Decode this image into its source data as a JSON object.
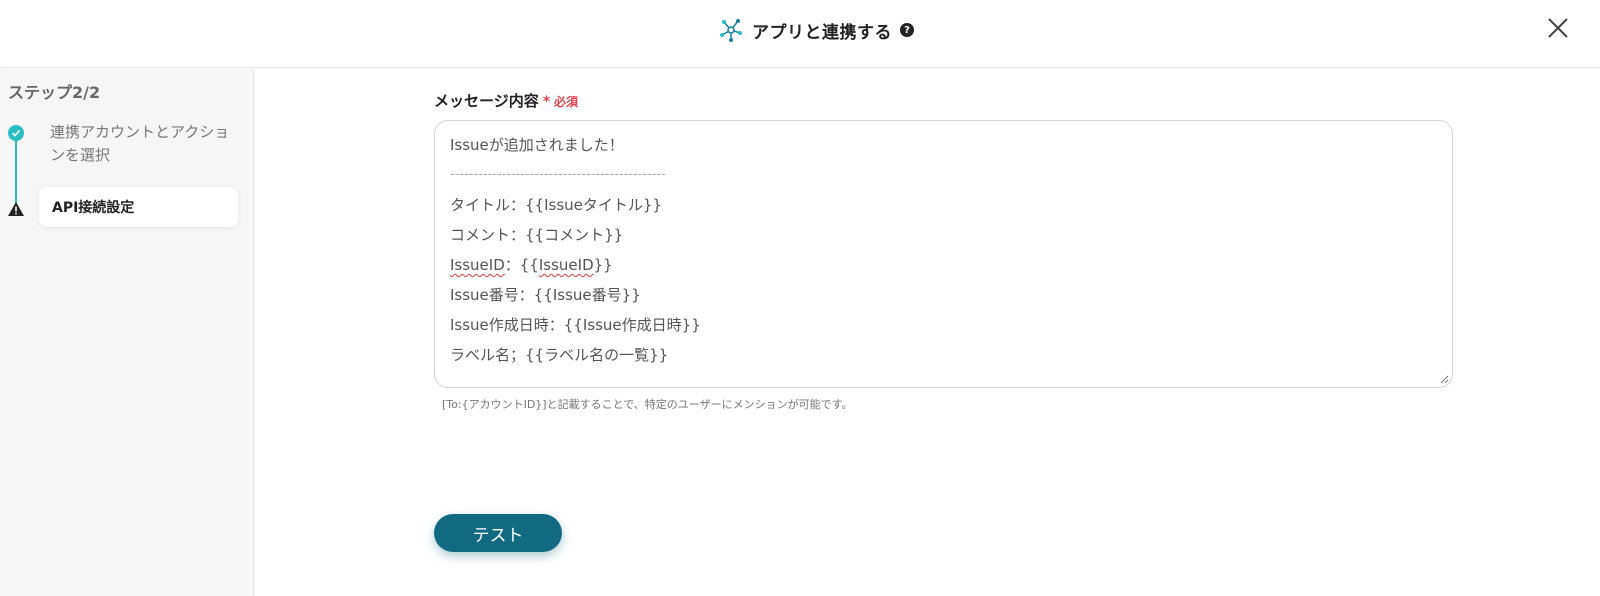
{
  "header": {
    "title": "アプリと連携する",
    "help_glyph": "?",
    "app_icon": "network-hub-icon",
    "close_icon": "close-icon"
  },
  "sidebar": {
    "step_heading": "ステップ2/2",
    "steps": [
      {
        "label": "連携アカウントとアクションを選択",
        "status": "done",
        "icon": "check-circle-icon"
      },
      {
        "label": "API接続設定",
        "status": "warning",
        "icon": "warning-triangle-icon"
      }
    ]
  },
  "form": {
    "message_label": "メッセージ内容",
    "required_star": "*",
    "required_text": "必須",
    "message_lines": [
      "Issueが追加されました！",
      "----------------------------------------------",
      "タイトル：{{Issueタイトル}}",
      "コメント：{{コメント}}",
      "IssueID：{{IssueID}}",
      "Issue番号：{{Issue番号}}",
      "Issue作成日時：{{Issue作成日時}}",
      "ラベル名；{{ラベル名の一覧}}"
    ],
    "message_line5": {
      "part1": "IssueID",
      "part2": "：{{",
      "part3": "IssueID",
      "part4": "}}"
    },
    "hint": "[To:{アカウントID}]と記載することで、特定のユーザーにメンションが可能です。"
  },
  "actions": {
    "test_label": "テスト"
  },
  "colors": {
    "accent_teal": "#2bbdc4",
    "button_bg": "#126a82",
    "required_red": "#e6434f"
  }
}
